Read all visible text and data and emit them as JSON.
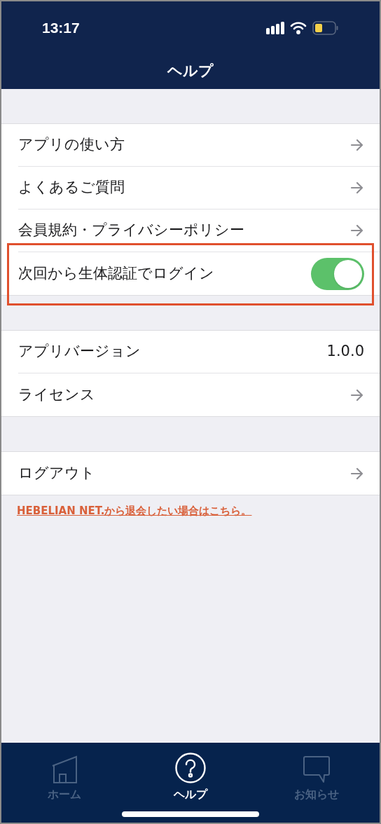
{
  "status_bar": {
    "time": "13:17"
  },
  "header": {
    "title": "ヘルプ"
  },
  "sections": [
    {
      "rows": [
        {
          "kind": "link",
          "label": "アプリの使い方"
        },
        {
          "kind": "link",
          "label": "よくあるご質問"
        },
        {
          "kind": "link",
          "label": "会員規約・プライバシーポリシー"
        },
        {
          "kind": "toggle",
          "label": "次回から生体認証でログイン",
          "on": true,
          "highlighted": true
        }
      ]
    },
    {
      "rows": [
        {
          "kind": "value",
          "label": "アプリバージョン",
          "value": "1.0.0"
        },
        {
          "kind": "link",
          "label": "ライセンス"
        }
      ]
    },
    {
      "rows": [
        {
          "kind": "link",
          "label": "ログアウト"
        }
      ]
    }
  ],
  "withdraw_link": "HEBELIAN NET.から退会したい場合はこちら。",
  "tab_bar": [
    {
      "kind": "home",
      "label": "ホーム",
      "selected": false
    },
    {
      "kind": "help",
      "label": "ヘルプ",
      "selected": true
    },
    {
      "kind": "chat",
      "label": "お知らせ",
      "selected": false
    }
  ]
}
